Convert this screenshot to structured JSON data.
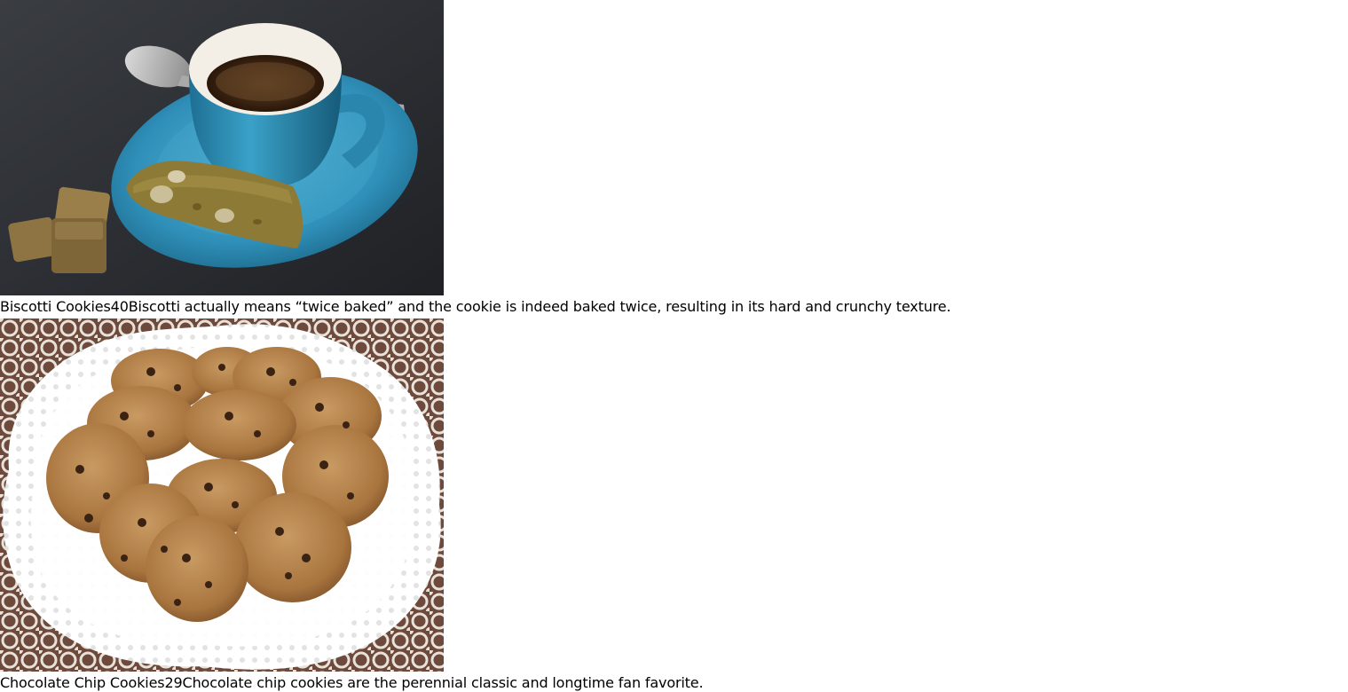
{
  "products": [
    {
      "name": "Biscotti Cookies",
      "price": "40",
      "description": "Biscotti actually means “twice baked” and the cookie is indeed baked twice, resulting in its hard and crunchy texture.",
      "image_icon": "biscotti-coffee-photo"
    },
    {
      "name": "Chocolate Chip Cookies",
      "price": "29",
      "description": "Chocolate chip cookies are the perennial classic and longtime fan favorite.",
      "image_icon": "chocolate-chip-cookies-photo"
    }
  ]
}
